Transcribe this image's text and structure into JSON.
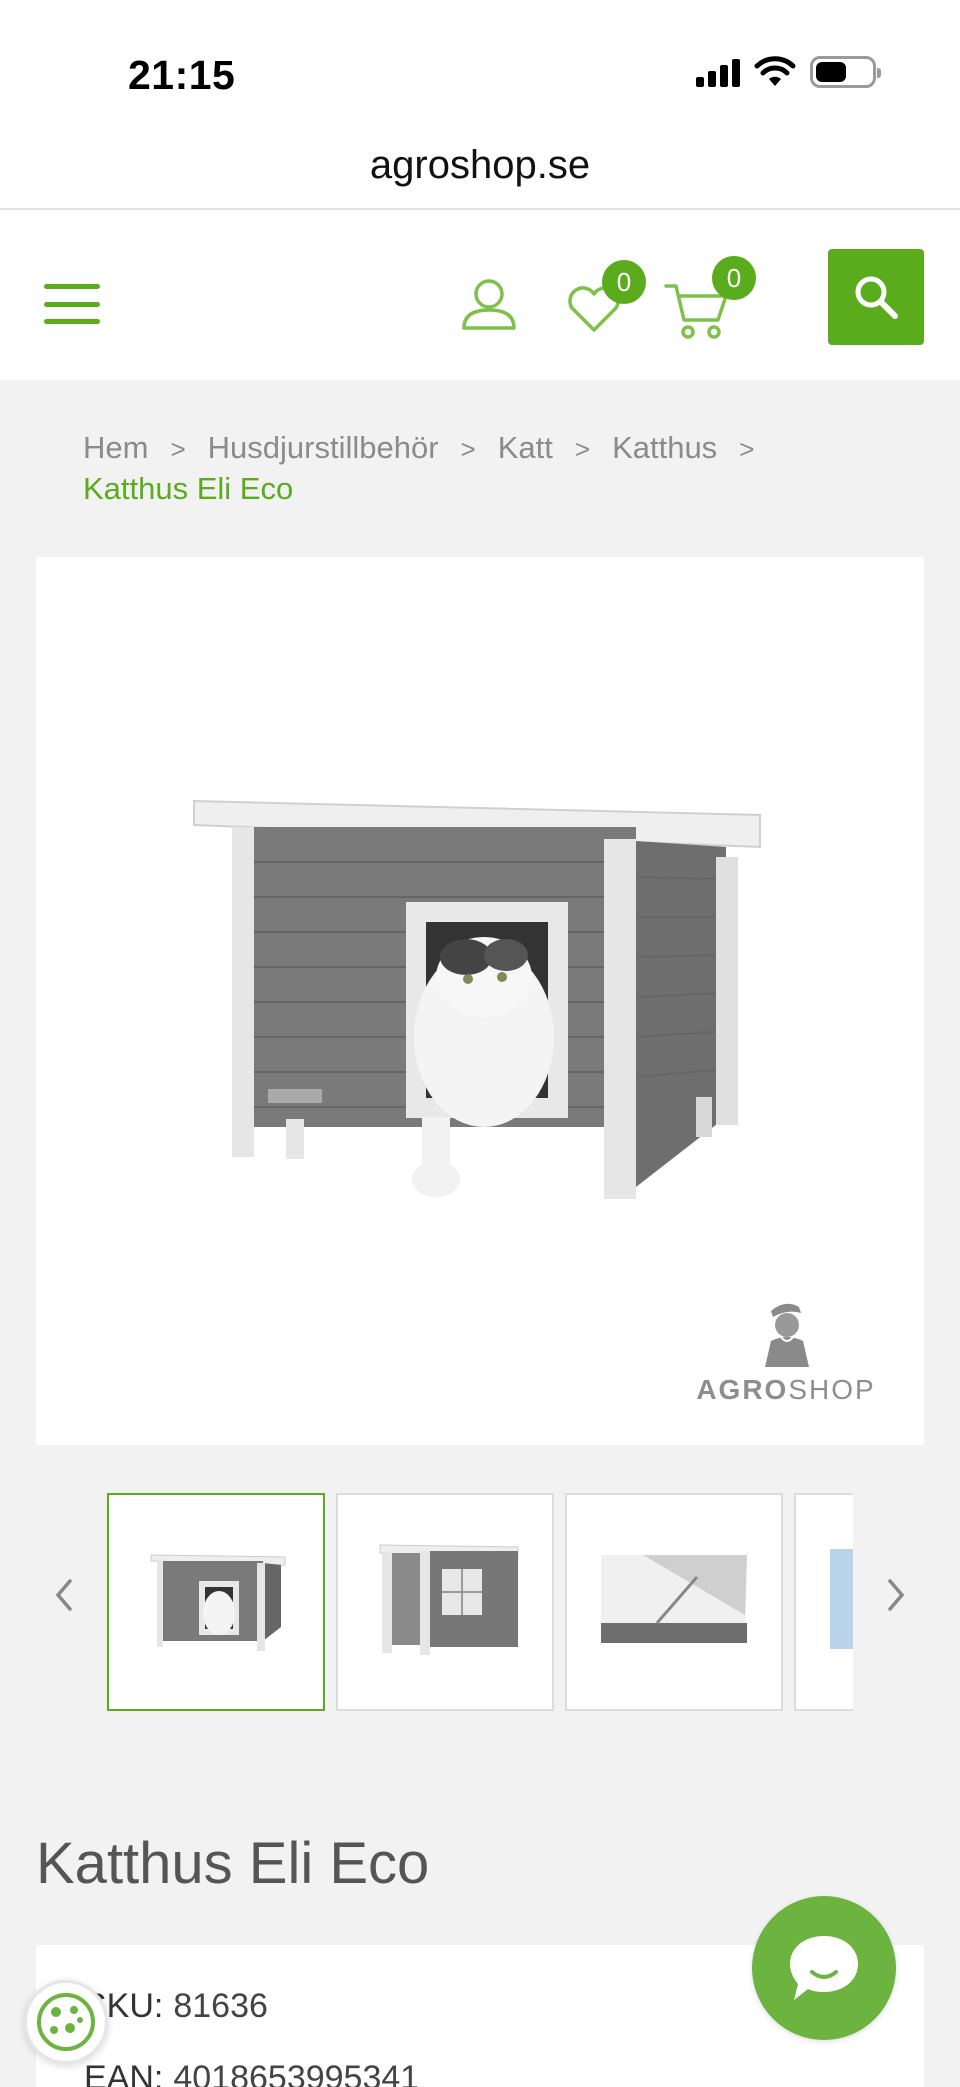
{
  "status": {
    "time": "21:15"
  },
  "browser": {
    "url": "agroshop.se"
  },
  "header": {
    "wishlist_count": "0",
    "cart_count": "0"
  },
  "breadcrumb": {
    "items": [
      "Hem",
      "Husdjurstillbehör",
      "Katt",
      "Katthus"
    ],
    "separator": ">",
    "current": "Katthus Eli Eco"
  },
  "image": {
    "watermark_a": "AGRO",
    "watermark_b": "SHOP"
  },
  "product": {
    "title": "Katthus Eli Eco",
    "sku_label": "SKU:",
    "sku": "81636",
    "ean_label": "EAN:",
    "ean": "4018653995341"
  },
  "colors": {
    "accent": "#5aac1c",
    "chat": "#6cb33f"
  }
}
